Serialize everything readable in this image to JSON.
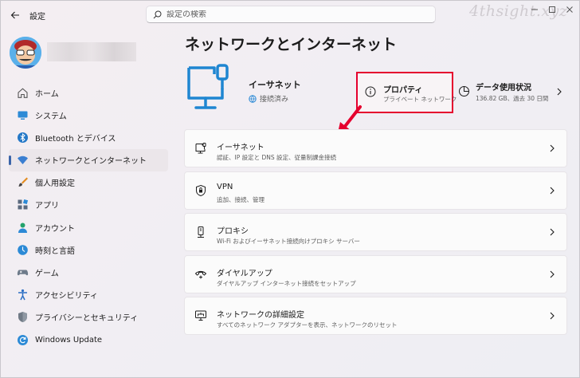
{
  "app": {
    "title": "設定",
    "search_placeholder": "設定の検索",
    "watermark": "4thsight.xyz"
  },
  "nav": {
    "items": [
      {
        "label": "ホーム",
        "icon": "home-icon"
      },
      {
        "label": "システム",
        "icon": "system-icon"
      },
      {
        "label": "Bluetooth とデバイス",
        "icon": "bluetooth-icon"
      },
      {
        "label": "ネットワークとインターネット",
        "icon": "network-icon",
        "active": true
      },
      {
        "label": "個人用設定",
        "icon": "brush-icon"
      },
      {
        "label": "アプリ",
        "icon": "apps-icon"
      },
      {
        "label": "アカウント",
        "icon": "account-icon"
      },
      {
        "label": "時刻と言語",
        "icon": "time-language-icon"
      },
      {
        "label": "ゲーム",
        "icon": "gamepad-icon"
      },
      {
        "label": "アクセシビリティ",
        "icon": "accessibility-icon"
      },
      {
        "label": "プライバシーとセキュリティ",
        "icon": "shield-icon"
      },
      {
        "label": "Windows Update",
        "icon": "update-icon"
      }
    ]
  },
  "main": {
    "title": "ネットワークとインターネット",
    "hero": {
      "name": "イーサネット",
      "status": "接続済み"
    },
    "properties": {
      "title": "プロパティ",
      "subtitle": "プライベート ネットワーク"
    },
    "data_usage": {
      "title": "データ使用状況",
      "subtitle": "136.82 GB、過去 30 日間"
    },
    "cards": [
      {
        "title": "イーサネット",
        "subtitle": "認証、IP 設定と DNS 設定、従量制課金接続",
        "icon": "ethernet-icon"
      },
      {
        "title": "VPN",
        "subtitle": "追加、接続、管理",
        "icon": "vpn-shield-icon"
      },
      {
        "title": "プロキシ",
        "subtitle": "Wi-Fi およびイーサネット接続向けプロキシ サーバー",
        "icon": "proxy-icon"
      },
      {
        "title": "ダイヤルアップ",
        "subtitle": "ダイヤルアップ インターネット接続をセットアップ",
        "icon": "dialup-icon"
      },
      {
        "title": "ネットワークの詳細設定",
        "subtitle": "すべてのネットワーク アダプターを表示、ネットワークのリセット",
        "icon": "advanced-network-icon"
      }
    ]
  },
  "colors": {
    "accent": "#3b64a9",
    "ethernet_blue": "#1f86d1",
    "highlight_red": "#e5002e"
  }
}
